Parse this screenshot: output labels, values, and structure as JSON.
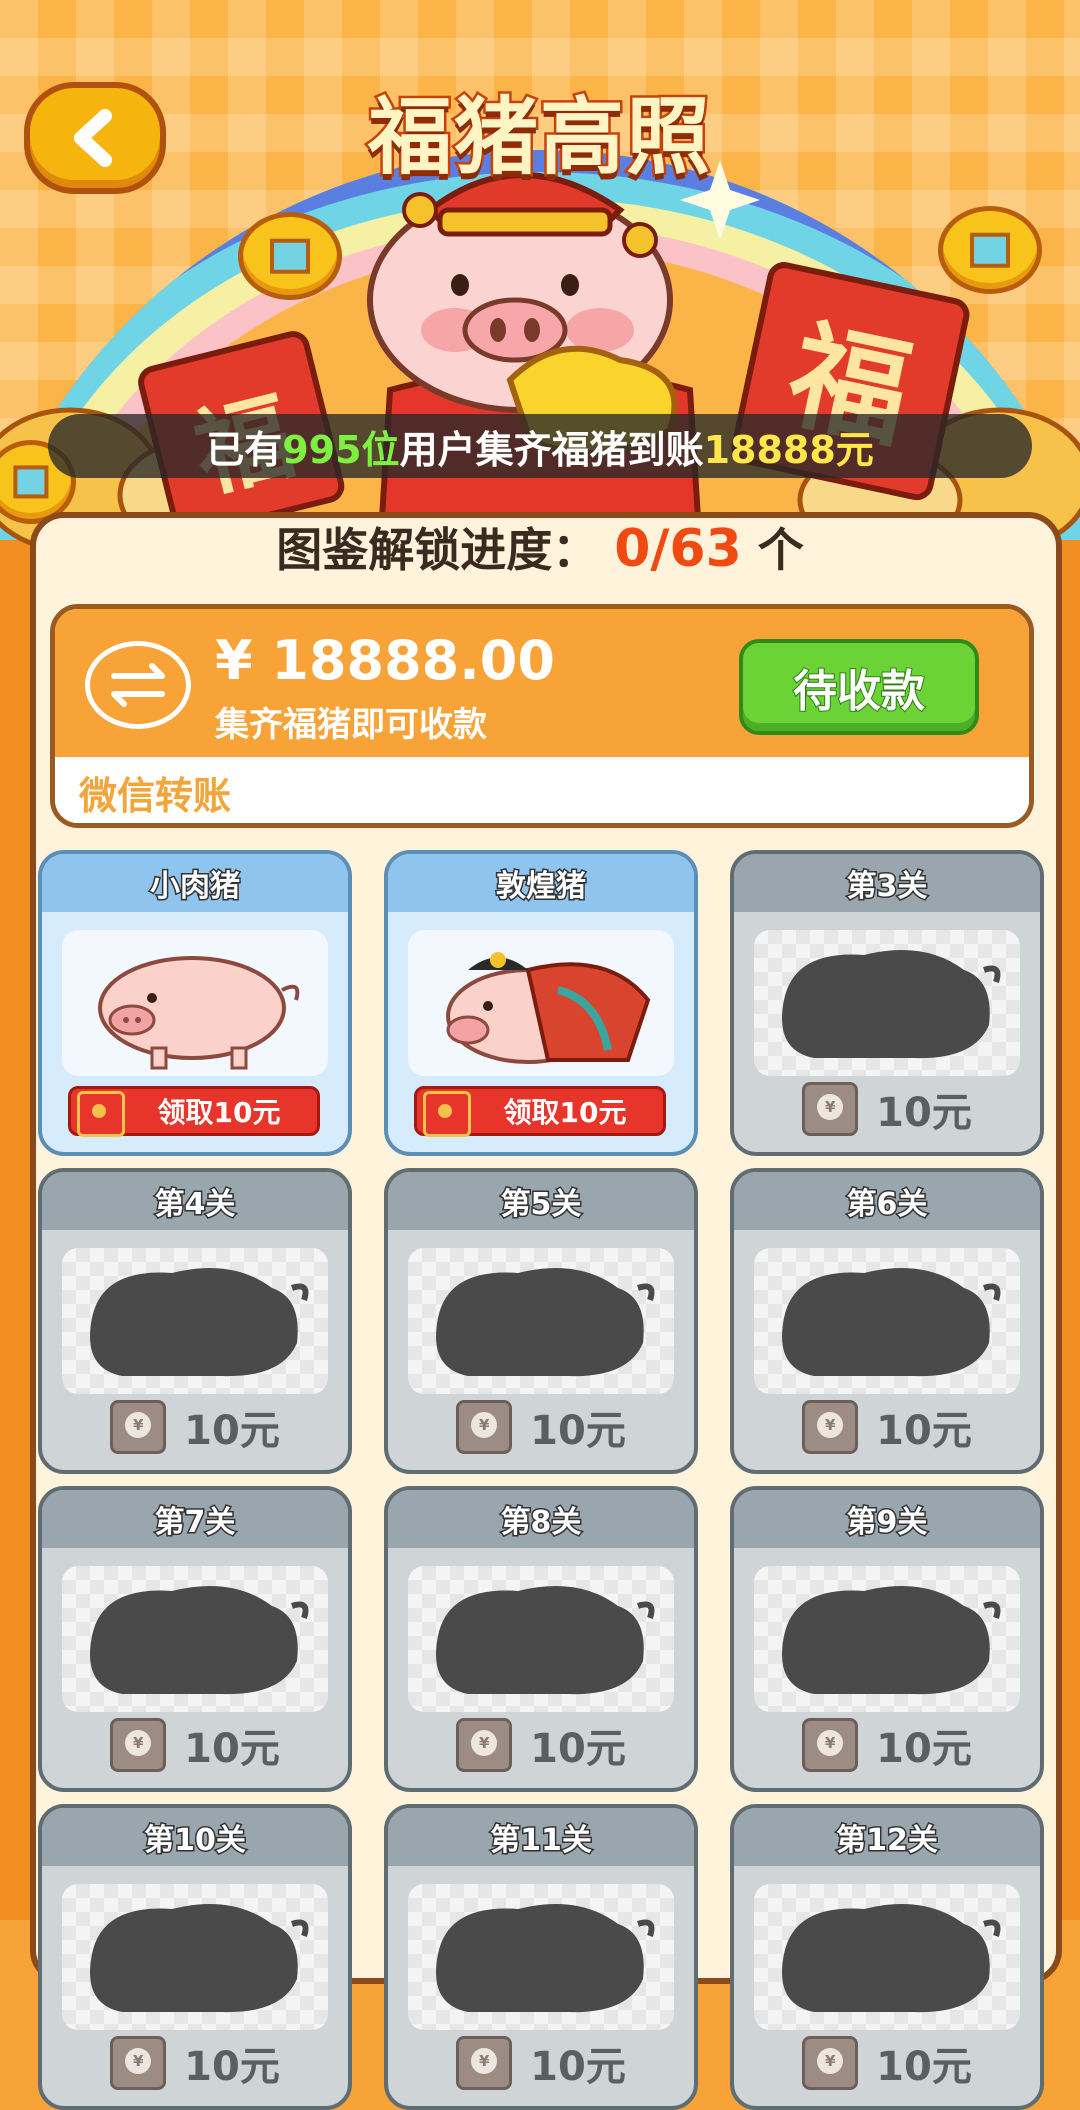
{
  "header": {
    "title": "福猪高照"
  },
  "ticker": {
    "prefix": "已有",
    "count": "995位",
    "middle": "用户集齐福猪到账",
    "amount": "18888元"
  },
  "progress": {
    "label": "图鉴解锁进度：",
    "value": "0/63",
    "unit": "个"
  },
  "transfer": {
    "amount": "¥ 18888.00",
    "subtitle": "集齐福猪即可收款",
    "button": "待收款",
    "footer": "微信转账"
  },
  "hero": {
    "banner_char": "福"
  },
  "cards": [
    {
      "title": "小肉猪",
      "reward": "领取10元",
      "state": "unlocked"
    },
    {
      "title": "敦煌猪",
      "reward": "领取10元",
      "state": "unlocked"
    },
    {
      "title": "第3关",
      "reward": "10元",
      "state": "locked"
    },
    {
      "title": "第4关",
      "reward": "10元",
      "state": "locked"
    },
    {
      "title": "第5关",
      "reward": "10元",
      "state": "locked"
    },
    {
      "title": "第6关",
      "reward": "10元",
      "state": "locked"
    },
    {
      "title": "第7关",
      "reward": "10元",
      "state": "locked"
    },
    {
      "title": "第8关",
      "reward": "10元",
      "state": "locked"
    },
    {
      "title": "第9关",
      "reward": "10元",
      "state": "locked"
    },
    {
      "title": "第10关",
      "reward": "10元",
      "state": "locked"
    },
    {
      "title": "第11关",
      "reward": "10元",
      "state": "locked"
    },
    {
      "title": "第12关",
      "reward": "10元",
      "state": "locked"
    }
  ],
  "colors": {
    "accent": "#f28e22",
    "green_button": "#6bd335",
    "red_button": "#e8352b",
    "progress_num": "#f04a12"
  }
}
